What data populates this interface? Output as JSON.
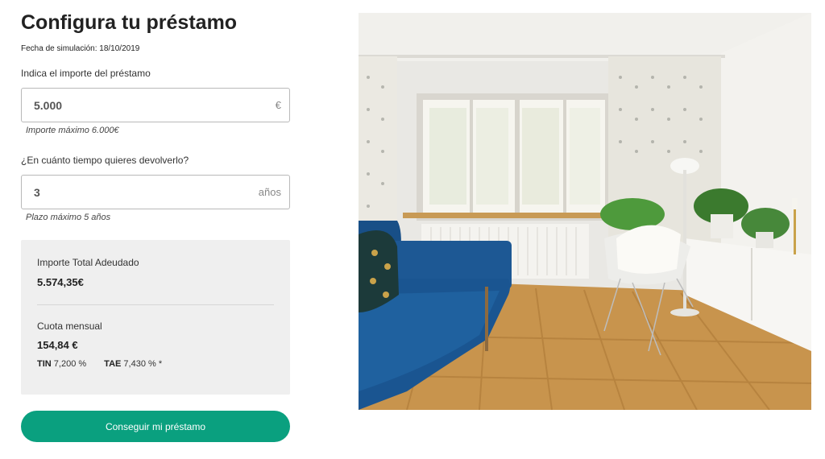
{
  "header": {
    "title": "Configura tu préstamo",
    "date_label": "Fecha de simulación: 18/10/2019"
  },
  "amount": {
    "label": "Indica el importe del préstamo",
    "value": "5.000",
    "unit": "€",
    "hint": "Importe máximo 6.000€"
  },
  "term": {
    "label": "¿En cuánto tiempo quieres devolverlo?",
    "value": "3",
    "unit": "años",
    "hint": "Plazo máximo 5 años"
  },
  "summary": {
    "total_label": "Importe Total Adeudado",
    "total_value": "5.574,35€",
    "monthly_label": "Cuota mensual",
    "monthly_value": "154,84 €",
    "tin_label": "TIN",
    "tin_value": "7,200 %",
    "tae_label": "TAE",
    "tae_value": "7,430 % *"
  },
  "cta": {
    "label": "Conseguir mi préstamo",
    "color": "#0aa07f"
  },
  "image": {
    "icon": "living-room-photo"
  }
}
